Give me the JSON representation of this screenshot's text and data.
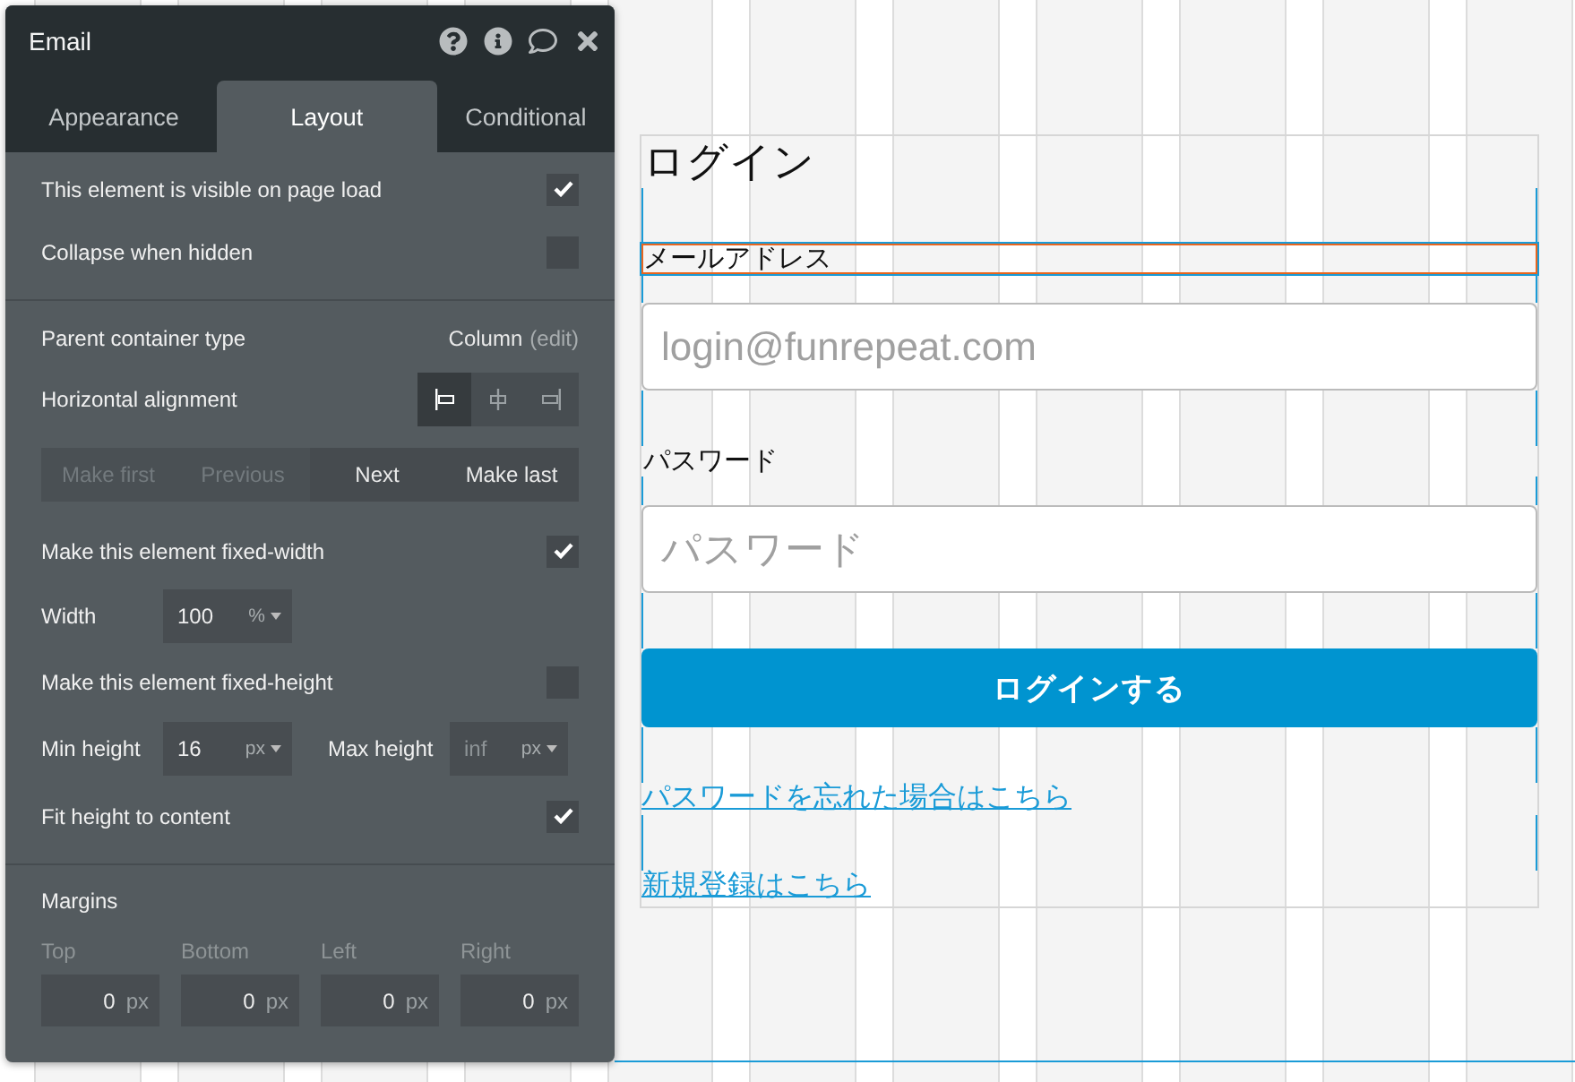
{
  "panel": {
    "title": "Email",
    "tabs": [
      {
        "label": "Appearance",
        "selected": false
      },
      {
        "label": "Layout",
        "selected": true
      },
      {
        "label": "Conditional",
        "selected": false
      }
    ],
    "sections": [
      {
        "rows": [
          {
            "kind": "checkbox",
            "label": "This element is visible on page load",
            "checked": true
          },
          {
            "kind": "checkbox",
            "label": "Collapse when hidden",
            "checked": false
          }
        ]
      },
      {
        "rows": [
          {
            "kind": "container",
            "label": "Parent container type",
            "value": "Column",
            "action": "(edit)"
          },
          {
            "kind": "alignment",
            "label": "Horizontal alignment",
            "options": [
              {
                "selected": true
              },
              {
                "selected": false
              },
              {
                "selected": false
              }
            ]
          },
          {
            "kind": "order",
            "buttons": [
              {
                "label": "Make first",
                "disabled": true
              },
              {
                "label": "Previous",
                "disabled": true
              },
              {
                "label": "Next",
                "disabled": false
              },
              {
                "label": "Make last",
                "disabled": false
              }
            ]
          },
          {
            "kind": "checkbox",
            "label": "Make this element fixed-width",
            "checked": true
          },
          {
            "kind": "width",
            "label": "Width",
            "value": "100",
            "unit": "%"
          },
          {
            "kind": "checkbox",
            "label": "Make this element fixed-height",
            "checked": false
          },
          {
            "kind": "minmax",
            "min_label": "Min height",
            "min_value": "16",
            "min_unit": "px",
            "max_label": "Max height",
            "max_placeholder": "inf",
            "max_unit": "px"
          },
          {
            "kind": "checkbox",
            "label": "Fit height to content",
            "checked": true
          }
        ]
      },
      {
        "rows": [
          {
            "kind": "margins",
            "title": "Margins",
            "fields": [
              {
                "label": "Top",
                "value": "0",
                "unit": "px"
              },
              {
                "label": "Bottom",
                "value": "0",
                "unit": "px"
              },
              {
                "label": "Left",
                "value": "0",
                "unit": "px"
              },
              {
                "label": "Right",
                "value": "0",
                "unit": "px"
              }
            ]
          }
        ]
      }
    ]
  },
  "canvas": {
    "elements": [
      {
        "kind": "heading",
        "text": "ログイン"
      },
      {
        "kind": "label",
        "text": "メールアドレス",
        "selected": true
      },
      {
        "kind": "input",
        "placeholder": "login@funrepeat.com"
      },
      {
        "kind": "label",
        "text": "パスワード",
        "selected": false
      },
      {
        "kind": "input",
        "placeholder": "パスワード"
      },
      {
        "kind": "button",
        "label": "ログインする"
      },
      {
        "kind": "link",
        "text": "パスワードを忘れた場合はこちら"
      },
      {
        "kind": "link",
        "text": "新規登録はこちら"
      }
    ]
  }
}
